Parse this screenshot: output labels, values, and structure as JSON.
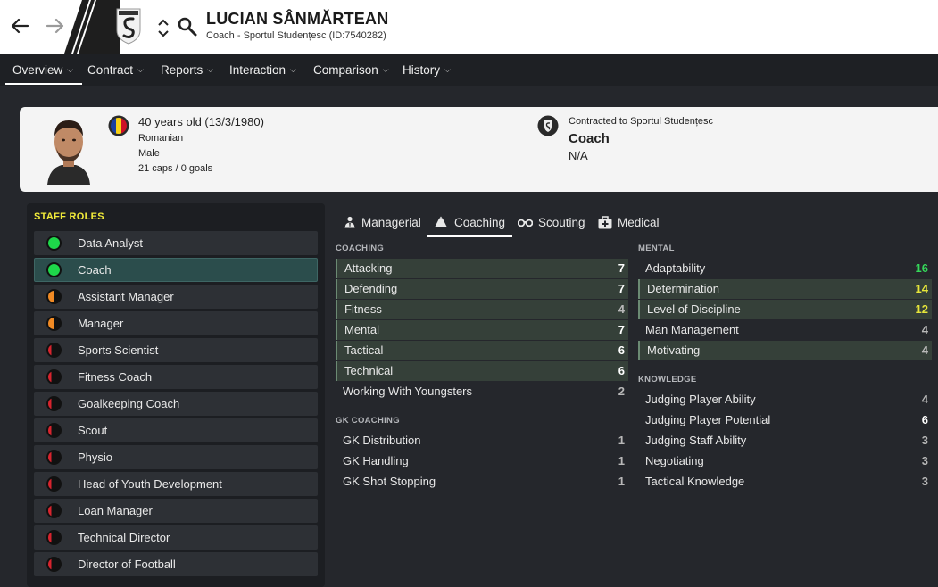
{
  "header": {
    "name": "LUCIAN SÂNMĂRTEAN",
    "subtitle": "Coach - Sportul Studențesc (ID:7540282)"
  },
  "menu": [
    {
      "label": "Overview",
      "active": true
    },
    {
      "label": "Contract"
    },
    {
      "label": "Reports"
    },
    {
      "label": "Interaction"
    },
    {
      "label": "Comparison"
    },
    {
      "label": "History"
    }
  ],
  "bio": {
    "age": "40 years old (13/3/1980)",
    "nationality": "Romanian",
    "gender": "Male",
    "caps": "21 caps / 0 goals",
    "contract_club": "Contracted to Sportul Studențesc",
    "contract_role": "Coach",
    "contract_value": "N/A"
  },
  "roles": {
    "title": "STAFF ROLES",
    "items": [
      {
        "label": "Data Analyst",
        "status": "green"
      },
      {
        "label": "Coach",
        "status": "green",
        "selected": true
      },
      {
        "label": "Assistant Manager",
        "status": "half-orange"
      },
      {
        "label": "Manager",
        "status": "half-orange"
      },
      {
        "label": "Sports Scientist",
        "status": "half-red"
      },
      {
        "label": "Fitness Coach",
        "status": "half-red"
      },
      {
        "label": "Goalkeeping Coach",
        "status": "half-red"
      },
      {
        "label": "Scout",
        "status": "half-red"
      },
      {
        "label": "Physio",
        "status": "half-red"
      },
      {
        "label": "Head of Youth Development",
        "status": "half-red"
      },
      {
        "label": "Loan Manager",
        "status": "half-red"
      },
      {
        "label": "Technical Director",
        "status": "half-red"
      },
      {
        "label": "Director of Football",
        "status": "half-red"
      }
    ]
  },
  "tabs": [
    {
      "label": "Managerial",
      "icon": "managerial-icon"
    },
    {
      "label": "Coaching",
      "icon": "whistle-icon",
      "active": true
    },
    {
      "label": "Scouting",
      "icon": "binoculars-icon"
    },
    {
      "label": "Medical",
      "icon": "medical-kit-icon"
    }
  ],
  "coaching": {
    "title": "COACHING",
    "items": [
      {
        "label": "Attacking",
        "value": "7"
      },
      {
        "label": "Defending",
        "value": "7"
      },
      {
        "label": "Fitness",
        "value": "4"
      },
      {
        "label": "Mental",
        "value": "7"
      },
      {
        "label": "Tactical",
        "value": "6"
      },
      {
        "label": "Technical",
        "value": "6"
      },
      {
        "label": "Working With Youngsters",
        "value": "2"
      }
    ]
  },
  "gk_coaching": {
    "title": "GK COACHING",
    "items": [
      {
        "label": "GK Distribution",
        "value": "1"
      },
      {
        "label": "GK Handling",
        "value": "1"
      },
      {
        "label": "GK Shot Stopping",
        "value": "1"
      }
    ]
  },
  "mental": {
    "title": "MENTAL",
    "items": [
      {
        "label": "Adaptability",
        "value": "16"
      },
      {
        "label": "Determination",
        "value": "14"
      },
      {
        "label": "Level of Discipline",
        "value": "12"
      },
      {
        "label": "Man Management",
        "value": "4"
      },
      {
        "label": "Motivating",
        "value": "4"
      }
    ]
  },
  "knowledge": {
    "title": "KNOWLEDGE",
    "items": [
      {
        "label": "Judging Player Ability",
        "value": "4"
      },
      {
        "label": "Judging Player Potential",
        "value": "6"
      },
      {
        "label": "Judging Staff Ability",
        "value": "3"
      },
      {
        "label": "Negotiating",
        "value": "3"
      },
      {
        "label": "Tactical Knowledge",
        "value": "3"
      }
    ]
  },
  "colors": {
    "accent_yellow": "#f2ec3a",
    "status_green": "#1ed74a",
    "status_orange": "#f08a24",
    "status_red": "#d8242e",
    "value_green": "#35d85a",
    "value_yellow": "#e6e63a"
  }
}
